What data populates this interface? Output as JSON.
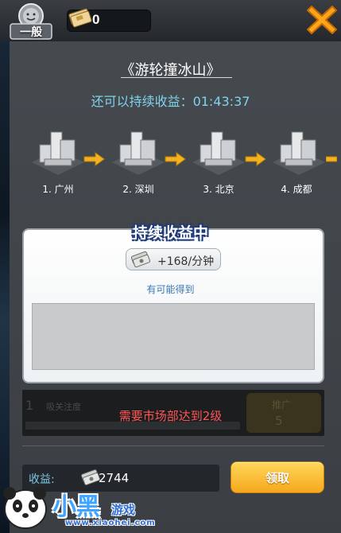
{
  "header": {
    "rank_label": "一般",
    "coin_value": "0"
  },
  "event": {
    "title": "《游轮撞冰山》",
    "timer_text": "还可以持续收益：01:43:37"
  },
  "route": {
    "cities": [
      {
        "label": "1. 广州"
      },
      {
        "label": "2. 深圳"
      },
      {
        "label": "3. 北京"
      },
      {
        "label": "4. 成都"
      }
    ]
  },
  "income_card": {
    "title": "持续收益中",
    "rate": "+168/分钟",
    "maybe_label": "有可能得到"
  },
  "promotion": {
    "index": "1",
    "label": "吸关注度",
    "button_label": "推广",
    "button_count": "5",
    "requirement": "需要市场部达到2级"
  },
  "footer": {
    "income_label": "收益:",
    "income_value": "2744",
    "claim_label": "领取"
  },
  "watermark": {
    "brand": "小黑",
    "sub": "游戏",
    "url": "www.xiaohei.com"
  },
  "colors": {
    "accent_blue": "#7fd3ea",
    "warning_red": "#ff5555",
    "claim_gold": "#f6a81d"
  }
}
